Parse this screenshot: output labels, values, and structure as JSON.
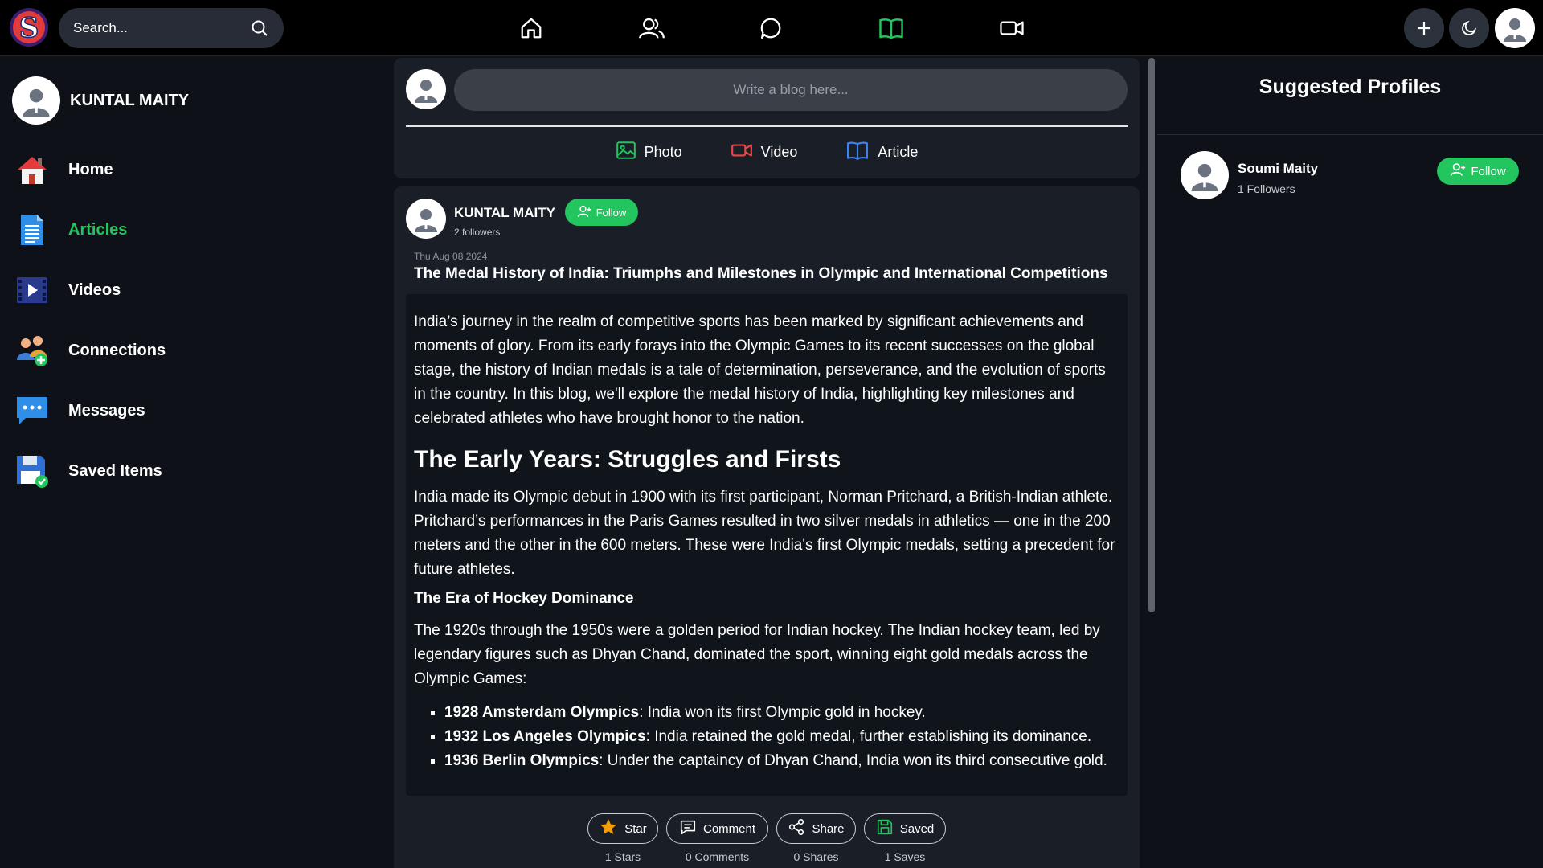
{
  "search": {
    "text": "Search..."
  },
  "nav": [
    "home-icon",
    "people-icon",
    "chat-icon",
    "book-icon",
    "video-icon"
  ],
  "colors": {
    "accent": "#22c55e",
    "background": "#0e1218",
    "panel": "#1a1f27"
  },
  "sidebar": {
    "profile_name": "KUNTAL MAITY",
    "items": [
      {
        "label": "Home",
        "icon": "house-icon"
      },
      {
        "label": "Articles",
        "icon": "articles-icon"
      },
      {
        "label": "Videos",
        "icon": "videos-icon"
      },
      {
        "label": "Connections",
        "icon": "connections-icon"
      },
      {
        "label": "Messages",
        "icon": "messages-icon"
      },
      {
        "label": "Saved Items",
        "icon": "saved-icon"
      }
    ]
  },
  "composer": {
    "placeholder": "Write a blog here...",
    "photo": "Photo",
    "video": "Video",
    "article": "Article"
  },
  "post": {
    "author": "KUNTAL MAITY",
    "follow_label": "Follow",
    "followers": "2 followers",
    "date": "Thu Aug 08 2024",
    "title": "The Medal History of India: Triumphs and Milestones in Olympic and International Competitions",
    "intro": "India’s journey in the realm of competitive sports has been marked by significant achievements and moments of glory. From its early forays into the Olympic Games to its recent successes on the global stage, the history of Indian medals is a tale of determination, perseverance, and the evolution of sports in the country. In this blog, we'll explore the medal history of India, highlighting key milestones and celebrated athletes who have brought honor to the nation.",
    "heading1": "The Early Years: Struggles and Firsts",
    "para1": "India made its Olympic debut in 1900 with its first participant, Norman Pritchard, a British-Indian athlete. Pritchard’s performances in the Paris Games resulted in two silver medals in athletics — one in the 200 meters and the other in the 600 meters. These were India's first Olympic medals, setting a precedent for future athletes.",
    "heading2": "The Era of Hockey Dominance",
    "para2": "The 1920s through the 1950s were a golden period for Indian hockey. The Indian hockey team, led by legendary figures such as Dhyan Chand, dominated the sport, winning eight gold medals across the Olympic Games:",
    "bullets": [
      {
        "bold": "1928 Amsterdam Olympics",
        "text": ": India won its first Olympic gold in hockey."
      },
      {
        "bold": "1932 Los Angeles Olympics",
        "text": ": India retained the gold medal, further establishing its dominance."
      },
      {
        "bold": "1936 Berlin Olympics",
        "text": ": Under the captaincy of Dhyan Chand, India won its third consecutive gold."
      }
    ],
    "actions": {
      "star": "Star",
      "star_count": "1 Stars",
      "comment": "Comment",
      "comment_count": "0 Comments",
      "share": "Share",
      "share_count": "0 Shares",
      "saved": "Saved",
      "saved_count": "1 Saves"
    }
  },
  "suggested": {
    "title": "Suggested Profiles",
    "profiles": [
      {
        "name": "Soumi Maity",
        "followers": "1 Followers",
        "follow_label": "Follow"
      }
    ]
  }
}
